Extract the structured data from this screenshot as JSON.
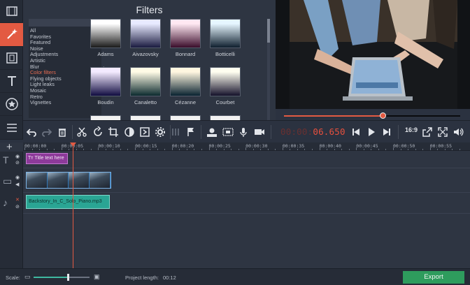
{
  "filters_panel": {
    "title": "Filters",
    "categories": [
      "All",
      "Favorites",
      "Featured",
      "Noise",
      "Adjustments",
      "Artistic",
      "Blur",
      "Color filters",
      "Flying objects",
      "Light leaks",
      "Mosaic",
      "Retro",
      "Vignettes"
    ],
    "selected_category": "Color filters",
    "thumbnails": [
      {
        "label": "Adams",
        "top": "#ffffff",
        "bottom": "#1a1a1a"
      },
      {
        "label": "Aivazovsky",
        "top": "#e8eaff",
        "bottom": "#1a1b40"
      },
      {
        "label": "Bonnard",
        "top": "#ffe8f2",
        "bottom": "#3a0c2a"
      },
      {
        "label": "Botticelli",
        "top": "#e6f6ff",
        "bottom": "#0f1f2e"
      },
      {
        "label": "Boudin",
        "top": "#f3eaff",
        "bottom": "#100c40"
      },
      {
        "label": "Canaletto",
        "top": "#fffbe6",
        "bottom": "#0b2a2e"
      },
      {
        "label": "Cézanne",
        "top": "#fff6e0",
        "bottom": "#082230"
      },
      {
        "label": "Courbet",
        "top": "#fffef0",
        "bottom": "#14102a"
      }
    ]
  },
  "toolbar": {
    "timecode_dim": "00:00:",
    "timecode_hot": "06.650",
    "aspect_ratio": "16:9"
  },
  "preview": {
    "seek_progress": 0.56
  },
  "timeline": {
    "ruler_ticks": [
      "00:00:00",
      "00:00:05",
      "00:00:10",
      "00:00:15",
      "00:00:20",
      "00:00:25",
      "00:00:30",
      "00:00:35",
      "00:00:40",
      "00:00:45",
      "00:00:50",
      "00:00:55"
    ],
    "title_clip": "Title text here",
    "audio_clip": "Backstory_In_C_Solo_Piano.mp3"
  },
  "statusbar": {
    "scale_label": "Scale:",
    "project_length_label": "Project length:",
    "project_length_value": "00:12",
    "scale_level": 0.62,
    "export_label": "Export"
  }
}
